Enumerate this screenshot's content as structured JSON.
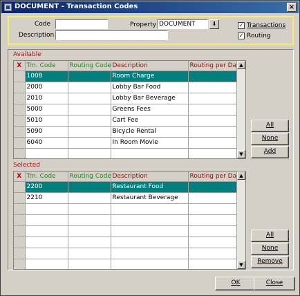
{
  "window": {
    "title": "DOCUMENT - Transaction Codes",
    "close_glyph": "×"
  },
  "criteria": {
    "code_label": "Code",
    "code_value": "",
    "description_label": "Description",
    "description_value": "",
    "property_label": "Property",
    "property_value": "DOCUMENT",
    "property_lov_glyph": "⬇",
    "transactions_label": "Transactions",
    "transactions_checked": true,
    "routing_label": "Routing",
    "routing_checked": true,
    "check_glyph": "✓"
  },
  "columns": {
    "x": "X",
    "trn_code": "Trn. Code",
    "routing_code": "Routing Code",
    "description": "Description",
    "routing_per_day": "Routing per Day"
  },
  "available": {
    "label": "Available",
    "rows": [
      {
        "trn_code": "1008",
        "routing_code": "",
        "description": "Room Charge",
        "routing_per_day": "",
        "selected": true
      },
      {
        "trn_code": "2000",
        "routing_code": "",
        "description": "Lobby Bar Food",
        "routing_per_day": ""
      },
      {
        "trn_code": "2010",
        "routing_code": "",
        "description": "Lobby Bar Beverage",
        "routing_per_day": ""
      },
      {
        "trn_code": "5000",
        "routing_code": "",
        "description": "Greens Fees",
        "routing_per_day": ""
      },
      {
        "trn_code": "5010",
        "routing_code": "",
        "description": "Cart Fee",
        "routing_per_day": ""
      },
      {
        "trn_code": "5090",
        "routing_code": "",
        "description": "Bicycle Rental",
        "routing_per_day": ""
      },
      {
        "trn_code": "6040",
        "routing_code": "",
        "description": "In Room Movie",
        "routing_per_day": ""
      },
      {
        "trn_code": "",
        "routing_code": "",
        "description": "",
        "routing_per_day": ""
      }
    ],
    "buttons": {
      "all": "All",
      "none": "None",
      "add": "Add"
    }
  },
  "selected": {
    "label": "Selected",
    "rows": [
      {
        "trn_code": "2200",
        "routing_code": "",
        "description": "Restaurant Food",
        "routing_per_day": "",
        "selected": true
      },
      {
        "trn_code": "2210",
        "routing_code": "",
        "description": "Restaurant Beverage",
        "routing_per_day": ""
      },
      {
        "trn_code": "",
        "routing_code": "",
        "description": "",
        "routing_per_day": ""
      },
      {
        "trn_code": "",
        "routing_code": "",
        "description": "",
        "routing_per_day": ""
      },
      {
        "trn_code": "",
        "routing_code": "",
        "description": "",
        "routing_per_day": ""
      },
      {
        "trn_code": "",
        "routing_code": "",
        "description": "",
        "routing_per_day": ""
      },
      {
        "trn_code": "",
        "routing_code": "",
        "description": "",
        "routing_per_day": ""
      },
      {
        "trn_code": "",
        "routing_code": "",
        "description": "",
        "routing_per_day": ""
      }
    ],
    "buttons": {
      "all": "All",
      "none": "None",
      "remove": "Remove"
    }
  },
  "scrollbar": {
    "up_glyph": "▲",
    "down_glyph": "▼"
  },
  "footer": {
    "ok": "OK",
    "close": "Close"
  }
}
